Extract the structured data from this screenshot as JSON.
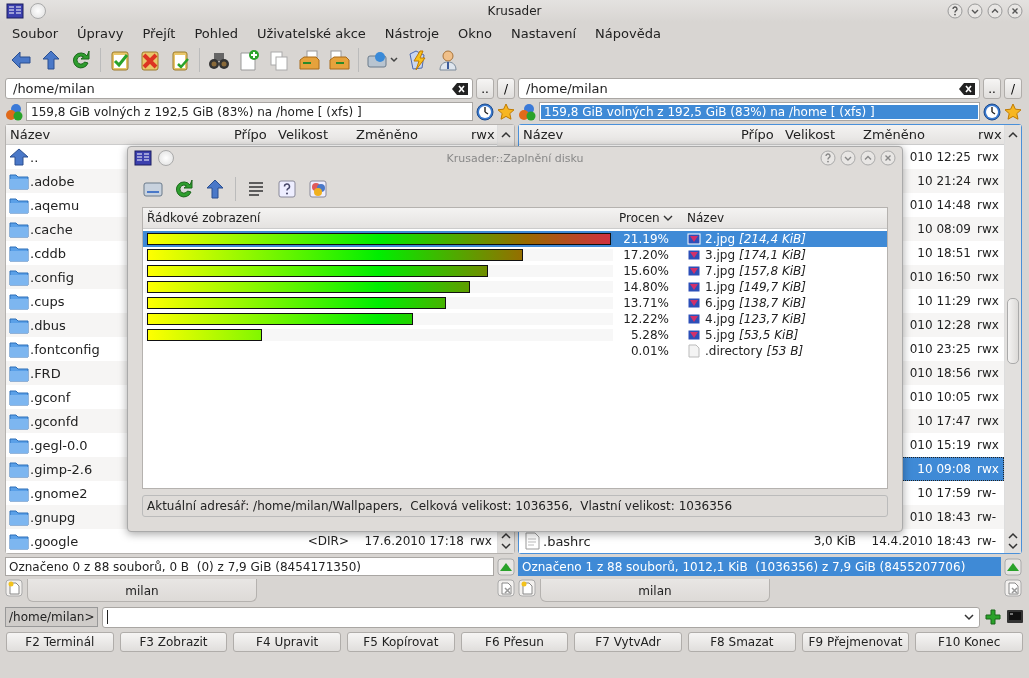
{
  "window": {
    "title": "Krusader"
  },
  "menu": [
    "Soubor",
    "Úpravy",
    "Přejít",
    "Pohled",
    "Uživatelské akce",
    "Nástroje",
    "Okno",
    "Nastavení",
    "Nápověda"
  ],
  "panels": [
    {
      "active": false,
      "path": "/home/milan",
      "up_button": "..",
      "root_button": "/",
      "free_space": "159,8 GiB volných z 192,5 GiB (83%) na /home [ (xfs) ]",
      "columns": [
        "Název",
        "Přípo",
        "Velikost",
        "Změněno",
        "rwx"
      ],
      "rows": [
        {
          "kind": "up",
          "name": "..",
          "selected": false
        },
        {
          "kind": "folder",
          "name": ".adobe",
          "selected": false
        },
        {
          "kind": "folder",
          "name": ".aqemu",
          "selected": false
        },
        {
          "kind": "folder",
          "name": ".cache",
          "selected": false
        },
        {
          "kind": "folder",
          "name": ".cddb",
          "selected": false
        },
        {
          "kind": "folder",
          "name": ".config",
          "selected": false
        },
        {
          "kind": "folder",
          "name": ".cups",
          "selected": false
        },
        {
          "kind": "folder",
          "name": ".dbus",
          "selected": false
        },
        {
          "kind": "folder",
          "name": ".fontconfig",
          "selected": false
        },
        {
          "kind": "folder",
          "name": ".FRD",
          "selected": false
        },
        {
          "kind": "folder",
          "name": ".gconf",
          "selected": false
        },
        {
          "kind": "folder",
          "name": ".gconfd",
          "selected": false
        },
        {
          "kind": "folder",
          "name": ".gegl-0.0",
          "selected": false
        },
        {
          "kind": "folder",
          "name": ".gimp-2.6",
          "selected": false
        },
        {
          "kind": "folder",
          "name": ".gnome2",
          "selected": false
        },
        {
          "kind": "folder",
          "name": ".gnupg",
          "selected": false
        },
        {
          "kind": "folder",
          "name": ".google",
          "size": "<DIR>",
          "date": "17.6.2010 17:18",
          "perms": "rwx",
          "selected": false
        }
      ],
      "status": "Označeno 0 z 88 souborů, 0 B  (0) z 7,9 GiB (8454171350)",
      "tab": "milan"
    },
    {
      "active": true,
      "path": "/home/milan",
      "up_button": "..",
      "root_button": "/",
      "free_space": "159,8 GiB volných z 192,5 GiB (83%) na /home [ (xfs) ]",
      "columns": [
        "Název",
        "Přípo",
        "Velikost",
        "Změněno",
        "rwx"
      ],
      "rows": [
        {
          "date": "010 12:25",
          "perms": "rwx",
          "selected": false
        },
        {
          "date": "10 21:24",
          "perms": "rwx",
          "selected": false
        },
        {
          "date": "010 14:48",
          "perms": "rwx",
          "selected": false
        },
        {
          "date": "10 08:09",
          "perms": "rwx",
          "selected": false
        },
        {
          "date": "10 18:51",
          "perms": "rwx",
          "selected": false
        },
        {
          "date": "010 16:50",
          "perms": "rwx",
          "selected": false
        },
        {
          "date": "10 11:29",
          "perms": "rwx",
          "selected": false
        },
        {
          "date": "010 12:28",
          "perms": "rwx",
          "selected": false
        },
        {
          "date": "010 23:25",
          "perms": "rwx",
          "selected": false
        },
        {
          "date": "010 18:56",
          "perms": "rwx",
          "selected": false
        },
        {
          "date": "010 10:05",
          "perms": "rwx",
          "selected": false
        },
        {
          "date": "10 17:47",
          "perms": "rwx",
          "selected": false
        },
        {
          "date": "010 15:19",
          "perms": "rwx",
          "selected": false
        },
        {
          "date": "10 09:08",
          "perms": "rwx",
          "selected": true
        },
        {
          "date": "10 17:59",
          "perms": "rw-",
          "selected": false
        },
        {
          "date": "010 18:43",
          "perms": "rw-",
          "selected": false
        },
        {
          "kind": "file",
          "name": ".bashrc",
          "size": "3,0 KiB",
          "date": "14.4.2010 18:43",
          "perms": "rw-",
          "selected": false
        }
      ],
      "status": "Označeno 1 z 88 souborů, 1012,1 KiB  (1036356) z 7,9 GiB (8455207706)",
      "tab": "milan"
    }
  ],
  "command_line": {
    "prompt": "/home/milan>"
  },
  "function_keys": [
    "F2 Terminál",
    "F3 Zobrazit",
    "F4 Upravit",
    "F5 Kopírovat",
    "F6 Přesun",
    "F7 VytvAdr",
    "F8 Smazat",
    "F9 Přejmenovat",
    "F10 Konec"
  ],
  "dialog": {
    "title": "Krusader::Zaplnění disku",
    "columns": [
      "Řádkové zobrazení",
      "Procen",
      "Název"
    ],
    "rows": [
      {
        "kind": "image",
        "level": 1.0,
        "percent": "21.19%",
        "name": "2.jpg",
        "size": "[214,4 KiB]",
        "selected": true
      },
      {
        "kind": "image",
        "level": 0.81,
        "percent": "17.20%",
        "name": "3.jpg",
        "size": "[174,1 KiB]",
        "selected": false
      },
      {
        "kind": "image",
        "level": 0.735,
        "percent": "15.60%",
        "name": "7.jpg",
        "size": "[157,8 KiB]",
        "selected": false
      },
      {
        "kind": "image",
        "level": 0.697,
        "percent": "14.80%",
        "name": "1.jpg",
        "size": "[149,7 KiB]",
        "selected": false
      },
      {
        "kind": "image",
        "level": 0.644,
        "percent": "13.71%",
        "name": "6.jpg",
        "size": "[138,7 KiB]",
        "selected": false
      },
      {
        "kind": "image",
        "level": 0.574,
        "percent": "12.22%",
        "name": "4.jpg",
        "size": "[123,7 KiB]",
        "selected": false
      },
      {
        "kind": "image",
        "level": 0.247,
        "percent": "5.28%",
        "name": "5.jpg",
        "size": "[53,5 KiB]",
        "selected": false
      },
      {
        "kind": "text",
        "percent": "0.01%",
        "name": ".directory",
        "size": "[53 B]",
        "selected": false
      }
    ],
    "status": "Aktuální adresář: /home/milan/Wallpapers,  Celková velikost: 1036356,  Vlastní velikost: 1036356"
  }
}
